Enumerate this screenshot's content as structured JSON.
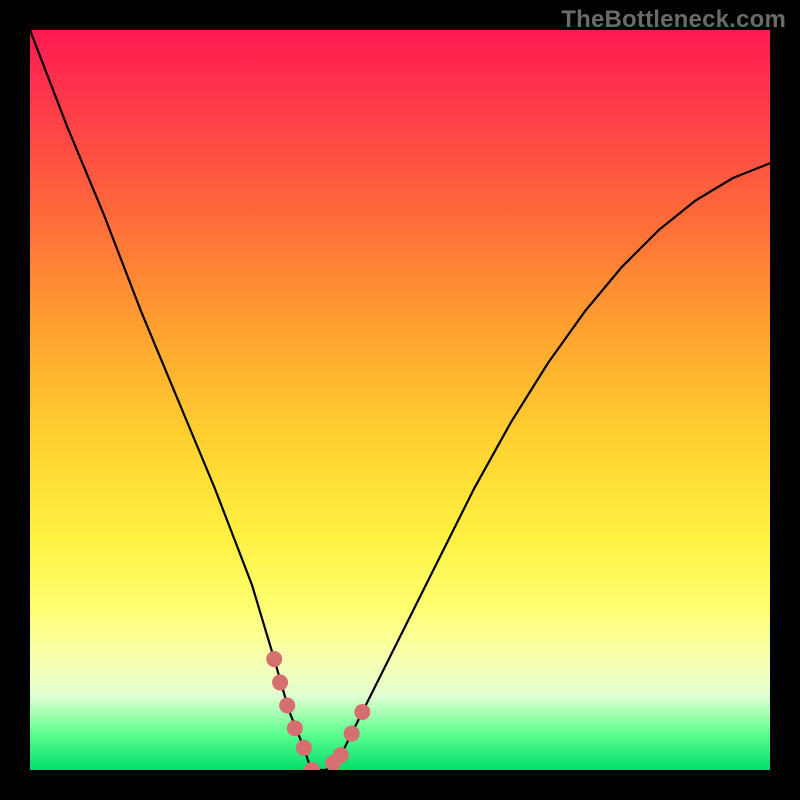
{
  "watermark": {
    "text": "TheBottleneck.com"
  },
  "chart_data": {
    "type": "line",
    "title": "",
    "xlabel": "",
    "ylabel": "",
    "xlim": [
      0,
      100
    ],
    "ylim": [
      0,
      100
    ],
    "grid": false,
    "legend": false,
    "series": [
      {
        "name": "bottleneck-curve",
        "color": "#000000",
        "x": [
          0,
          5,
          10,
          15,
          20,
          25,
          30,
          33,
          35,
          37,
          38,
          40,
          42,
          45,
          50,
          55,
          60,
          65,
          70,
          75,
          80,
          85,
          90,
          95,
          100
        ],
        "y": [
          100,
          87,
          75,
          62,
          50,
          38,
          25,
          15,
          8,
          3,
          0,
          0,
          2,
          8,
          18,
          28,
          38,
          47,
          55,
          62,
          68,
          73,
          77,
          80,
          82
        ]
      }
    ],
    "marker_segments": [
      {
        "name": "left-descent-marker",
        "color": "#d66f6f",
        "x": [
          33,
          34,
          35,
          36,
          37
        ],
        "y": [
          15,
          11,
          8,
          5,
          3
        ]
      },
      {
        "name": "valley-floor-marker",
        "color": "#d66f6f",
        "x": [
          37,
          38,
          39,
          40,
          41,
          42
        ],
        "y": [
          3,
          0,
          0,
          0,
          1,
          2
        ]
      },
      {
        "name": "right-ascent-marker",
        "color": "#d66f6f",
        "x": [
          42,
          43,
          44,
          45
        ],
        "y": [
          2,
          4,
          6,
          8
        ]
      }
    ],
    "gradient_stops": [
      {
        "pos": 0,
        "color": "#ff1a52"
      },
      {
        "pos": 10,
        "color": "#ff3a4a"
      },
      {
        "pos": 25,
        "color": "#ff6a3a"
      },
      {
        "pos": 40,
        "color": "#ffa030"
      },
      {
        "pos": 55,
        "color": "#ffd030"
      },
      {
        "pos": 68,
        "color": "#fff040"
      },
      {
        "pos": 78,
        "color": "#ffff70"
      },
      {
        "pos": 85,
        "color": "#f8ffb0"
      },
      {
        "pos": 90,
        "color": "#e0ffd0"
      },
      {
        "pos": 95,
        "color": "#60ff90"
      },
      {
        "pos": 100,
        "color": "#00dd6a"
      }
    ]
  }
}
